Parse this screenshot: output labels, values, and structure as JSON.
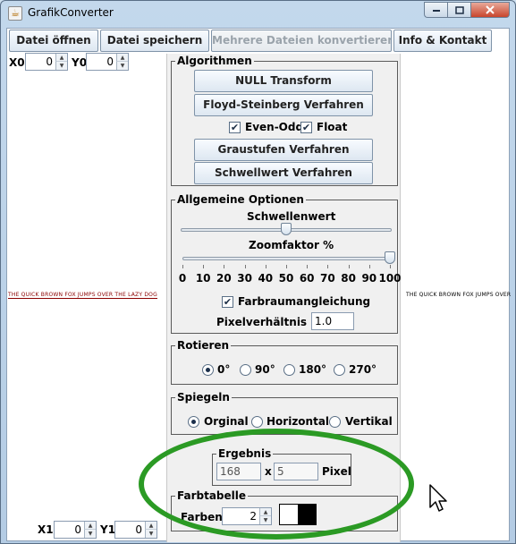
{
  "window": {
    "title": "GrafikConverter"
  },
  "toolbar": {
    "open": "Datei öffnen",
    "save": "Datei speichern",
    "batch": "Mehrere Dateien konvertieren",
    "info": "Info & Kontakt"
  },
  "coords": {
    "x0_label": "X0",
    "x0_value": "0",
    "y0_label": "Y0",
    "y0_value": "0",
    "x1_label": "X1",
    "x1_value": "0",
    "y1_label": "Y1",
    "y1_value": "0"
  },
  "preview": {
    "left_text": "THE QUICK BROWN FOX JUMPS OVER THE LAZY DOG",
    "right_text": "THE QUICK BROWN FOX JUMPS OVER"
  },
  "algorithms": {
    "title": "Algorithmen",
    "null_transform": "NULL Transform",
    "floyd": "Floyd-Steinberg Verfahren",
    "even_odd": "Even-Odd",
    "even_odd_checked": true,
    "float": "Float",
    "float_checked": true,
    "grayscale": "Graustufen Verfahren",
    "threshold": "Schwellwert Verfahren"
  },
  "options": {
    "title": "Allgemeine Optionen",
    "threshold_label": "Schwellenwert",
    "threshold_level": 0.5,
    "zoom_label": "Zoomfaktor %",
    "zoom_value": 100,
    "zoom_ticks": [
      "0",
      "10",
      "20",
      "30",
      "40",
      "50",
      "60",
      "70",
      "80",
      "90",
      "100"
    ],
    "color_match_label": "Farbraumangleichung",
    "color_match_checked": true,
    "aspect_label": "Pixelverhältnis 1 :",
    "aspect_value": "1.0"
  },
  "rotate": {
    "title": "Rotieren",
    "options": [
      "0°",
      "90°",
      "180°",
      "270°"
    ],
    "selected": "0°"
  },
  "mirror": {
    "title": "Spiegeln",
    "options": [
      "Orginal",
      "Horizontal",
      "Vertikal"
    ],
    "selected": "Orginal"
  },
  "result": {
    "title": "Ergebnis",
    "width": "168",
    "times": "x",
    "height": "5",
    "unit": "Pixel"
  },
  "palette": {
    "title": "Farbtabelle",
    "colors_label": "Farben:",
    "colors_value": "2",
    "swatches": [
      "#ffffff",
      "#000000"
    ]
  },
  "annotation": {
    "ellipse_color": "#2b9a24"
  }
}
